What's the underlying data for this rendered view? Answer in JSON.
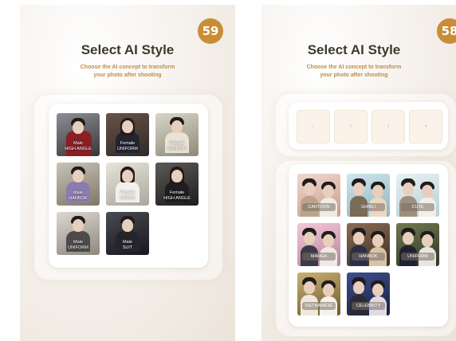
{
  "screen_a": {
    "timer": "59",
    "title": "Select AI Style",
    "subtitle_line1": "Choose the AI concept to transform",
    "subtitle_line2": "your photo after shooting",
    "styles": [
      {
        "line1": "Male",
        "line2": "HIGH ANGLE"
      },
      {
        "line1": "Female",
        "line2": "UNIFORM"
      },
      {
        "line1": "Female",
        "line2": "HANBOK"
      },
      {
        "line1": "Male",
        "line2": "HANBOK"
      },
      {
        "line1": "Female",
        "line2": "DRESS"
      },
      {
        "line1": "Female",
        "line2": "HIGH ANGLE"
      },
      {
        "line1": "Male",
        "line2": "UNIFORM"
      },
      {
        "line1": "Male",
        "line2": "SUIT"
      }
    ]
  },
  "screen_b": {
    "timer": "58",
    "title": "Select AI Style",
    "subtitle_line1": "Choose the AI concept to transform",
    "subtitle_line2": "your photo after shooting",
    "slots": [
      "1",
      "2",
      "3",
      "4"
    ],
    "styles": [
      {
        "label": "CARTOON"
      },
      {
        "label": "GHIBLI"
      },
      {
        "label": "CUTE"
      },
      {
        "label": "MANGA"
      },
      {
        "label": "HANBOK"
      },
      {
        "label": "UNIFORM"
      },
      {
        "label": "VIETNAMESE"
      },
      {
        "label": "CELEBRITY"
      }
    ]
  }
}
